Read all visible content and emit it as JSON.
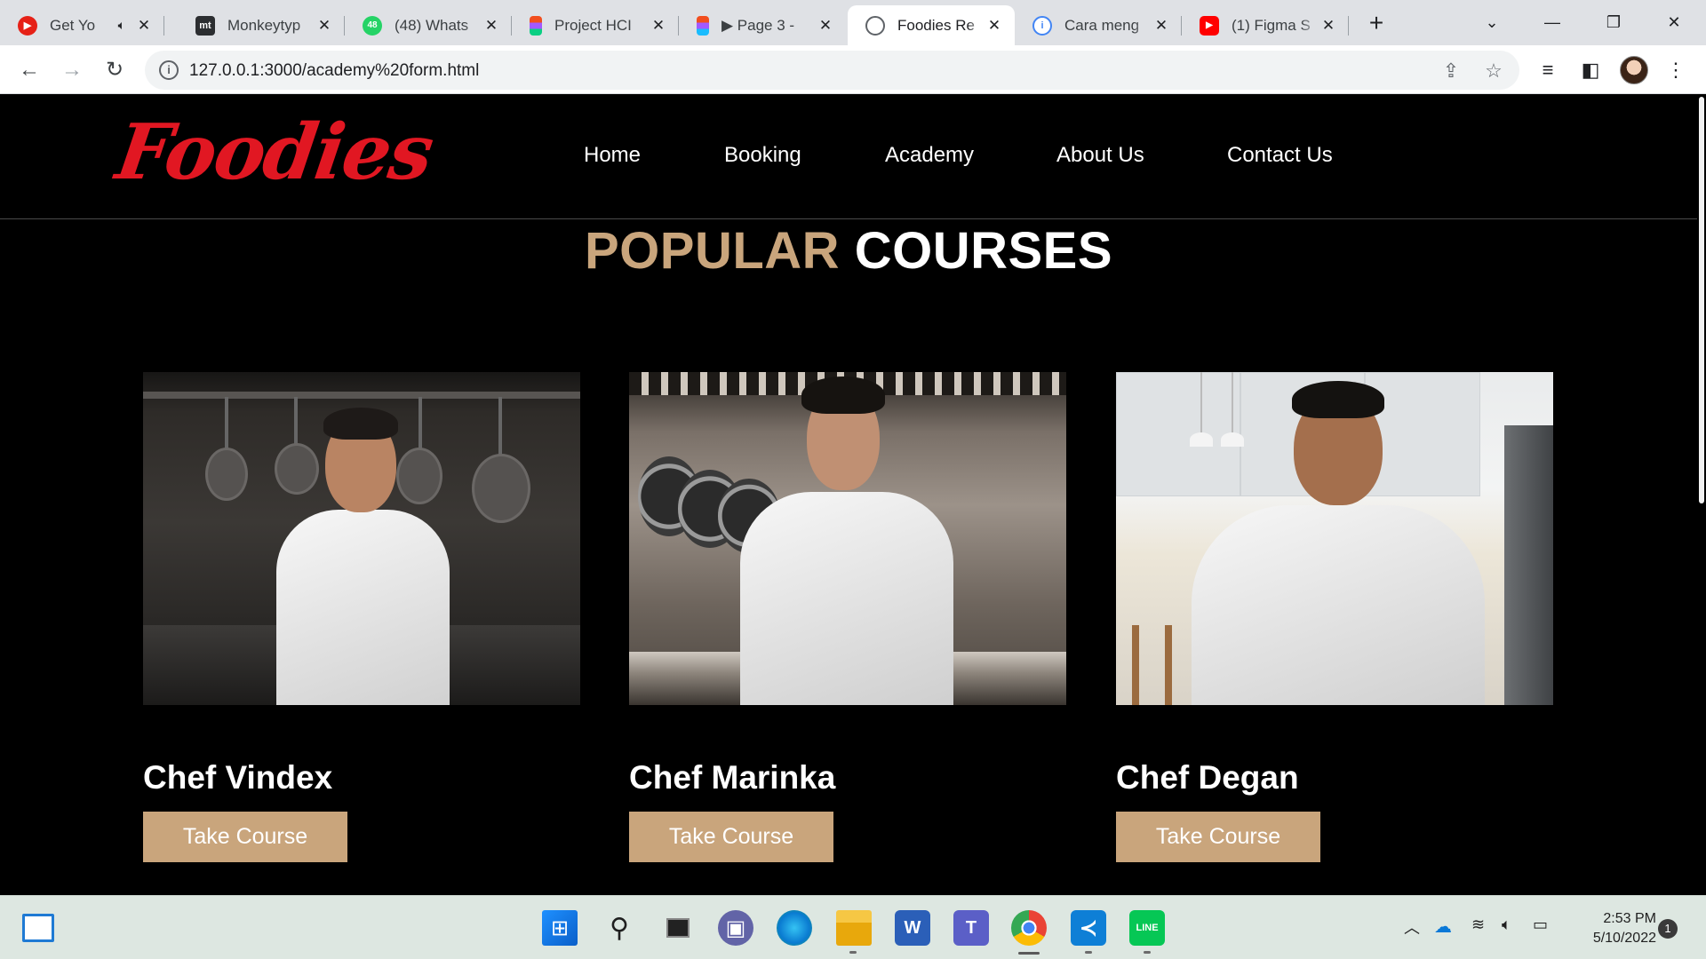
{
  "browser": {
    "tabs": [
      {
        "title": "Get Yo",
        "icon": "youtube-music-icon",
        "color": "#e62117",
        "glyph": "▶",
        "audio": true
      },
      {
        "title": "Monkeytyp",
        "icon": "monkeytype-icon",
        "color": "#2c2e31",
        "glyph": "mt"
      },
      {
        "title": "(48) Whats",
        "icon": "whatsapp-icon",
        "color": "#25d366",
        "glyph": "48"
      },
      {
        "title": "Project HCI",
        "icon": "figma-icon",
        "color": "#f24e1e",
        "glyph": "F"
      },
      {
        "title": "▶ Page 3 -",
        "icon": "figma-icon",
        "color": "#a259ff",
        "glyph": "F"
      },
      {
        "title": "Foodies Re",
        "icon": "globe-icon",
        "color": "#5f6368",
        "glyph": "◎",
        "active": true
      },
      {
        "title": "Cara meng",
        "icon": "info-site-icon",
        "color": "#4285f4",
        "glyph": "i"
      },
      {
        "title": "(1) Figma S",
        "icon": "youtube-icon",
        "color": "#ff0000",
        "glyph": "▶"
      }
    ],
    "new_tab": "+",
    "url": "127.0.0.1:3000/academy%20form.html"
  },
  "site": {
    "logo": "Foodies",
    "nav": [
      "Home",
      "Booking",
      "Academy",
      "About Us",
      "Contact Us"
    ],
    "heading_accent": "POPULAR",
    "heading_rest": "COURSES",
    "accent_color": "#c9a57c",
    "logo_color": "#e11722",
    "cards": [
      {
        "name": "Chef Vindex",
        "button": "Take Course"
      },
      {
        "name": "Chef Marinka",
        "button": "Take Course"
      },
      {
        "name": "Chef Degan",
        "button": "Take Course"
      }
    ]
  },
  "taskbar": {
    "time": "2:53 PM",
    "date": "5/10/2022",
    "notifications": "1"
  }
}
